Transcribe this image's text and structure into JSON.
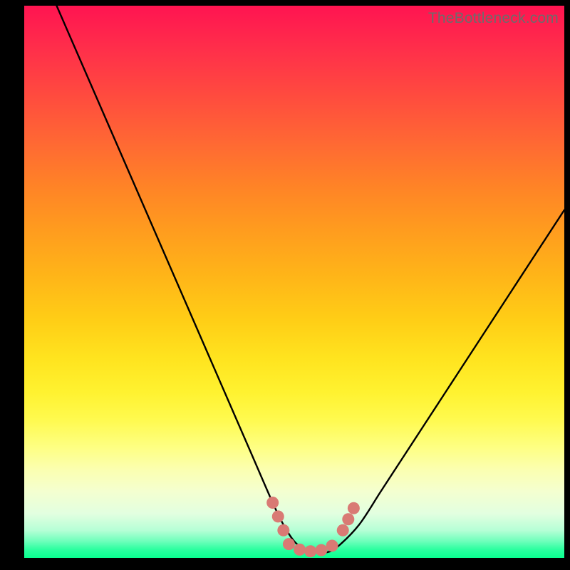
{
  "watermark": "TheBottleneck.com",
  "colors": {
    "frame": "#000000",
    "curve": "#000000",
    "marker": "#d97a74",
    "gradient_top": "#ff1451",
    "gradient_bottom": "#09ff90"
  },
  "chart_data": {
    "type": "line",
    "title": "",
    "xlabel": "",
    "ylabel": "",
    "xlim": [
      0,
      100
    ],
    "ylim": [
      0,
      100
    ],
    "series": [
      {
        "name": "bottleneck-curve",
        "x": [
          6,
          10,
          14,
          18,
          22,
          26,
          30,
          34,
          38,
          42,
          46,
          48,
          50,
          52,
          54,
          56,
          58,
          62,
          66,
          70,
          74,
          78,
          82,
          86,
          90,
          94,
          98,
          100
        ],
        "y": [
          100,
          91,
          82,
          73,
          64,
          55,
          46,
          37,
          28,
          19,
          10,
          6,
          3,
          1.5,
          1,
          1,
          2,
          6,
          12,
          18,
          24,
          30,
          36,
          42,
          48,
          54,
          60,
          63
        ]
      }
    ],
    "markers": [
      {
        "name": "cluster-left-1",
        "x": 46,
        "y": 10
      },
      {
        "name": "cluster-left-2",
        "x": 47,
        "y": 7.5
      },
      {
        "name": "cluster-left-3",
        "x": 48,
        "y": 5
      },
      {
        "name": "bottom-1",
        "x": 49,
        "y": 2.5
      },
      {
        "name": "bottom-2",
        "x": 51,
        "y": 1.5
      },
      {
        "name": "bottom-3",
        "x": 53,
        "y": 1.2
      },
      {
        "name": "bottom-4",
        "x": 55,
        "y": 1.4
      },
      {
        "name": "bottom-5",
        "x": 57,
        "y": 2.2
      },
      {
        "name": "cluster-right-1",
        "x": 59,
        "y": 5
      },
      {
        "name": "cluster-right-2",
        "x": 60,
        "y": 7
      },
      {
        "name": "cluster-right-3",
        "x": 61,
        "y": 9
      }
    ]
  }
}
